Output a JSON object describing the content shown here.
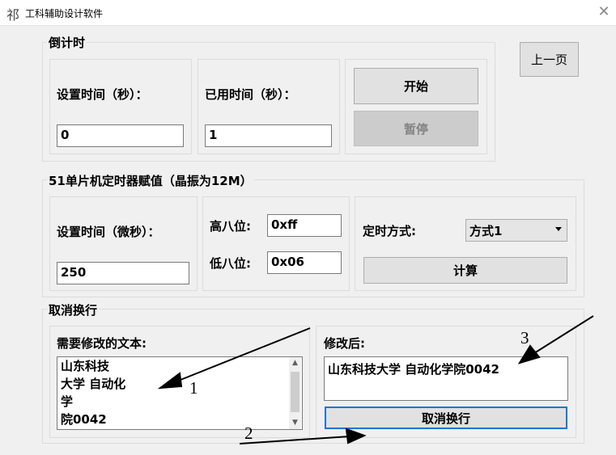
{
  "window": {
    "title": "工科辅助设计软件",
    "app_icon_glyph": "祁",
    "close_glyph": "✕"
  },
  "countdown": {
    "group_title": "倒计时",
    "set_time_label": "设置时间（秒）：",
    "set_time_value": "0",
    "used_time_label": "已用时间（秒）：",
    "used_time_value": "1",
    "start_button": "开始",
    "pause_button": "暂停"
  },
  "prev_page_button": "上一页",
  "timer51": {
    "group_title": "51单片机定时器赋值（晶振为12M）",
    "set_time_label": "设置时间（微秒）：",
    "set_time_value": "250",
    "high_label": "高八位:",
    "high_value": "0xff",
    "low_label": "低八位:",
    "low_value": "0x06",
    "mode_label": "定时方式:",
    "mode_selected": "方式1",
    "calc_button": "计算"
  },
  "cancel_wrap": {
    "group_title": "取消换行",
    "input_label": "需要修改的文本:",
    "input_lines": [
      "山东科技",
      "大学 自动化",
      "学",
      "院0042"
    ],
    "output_label": "修改后:",
    "output_text": "山东科技大学 自动化学院0042",
    "button": "取消换行"
  },
  "annotations": {
    "a1": "1",
    "a2": "2",
    "a3": "3"
  }
}
